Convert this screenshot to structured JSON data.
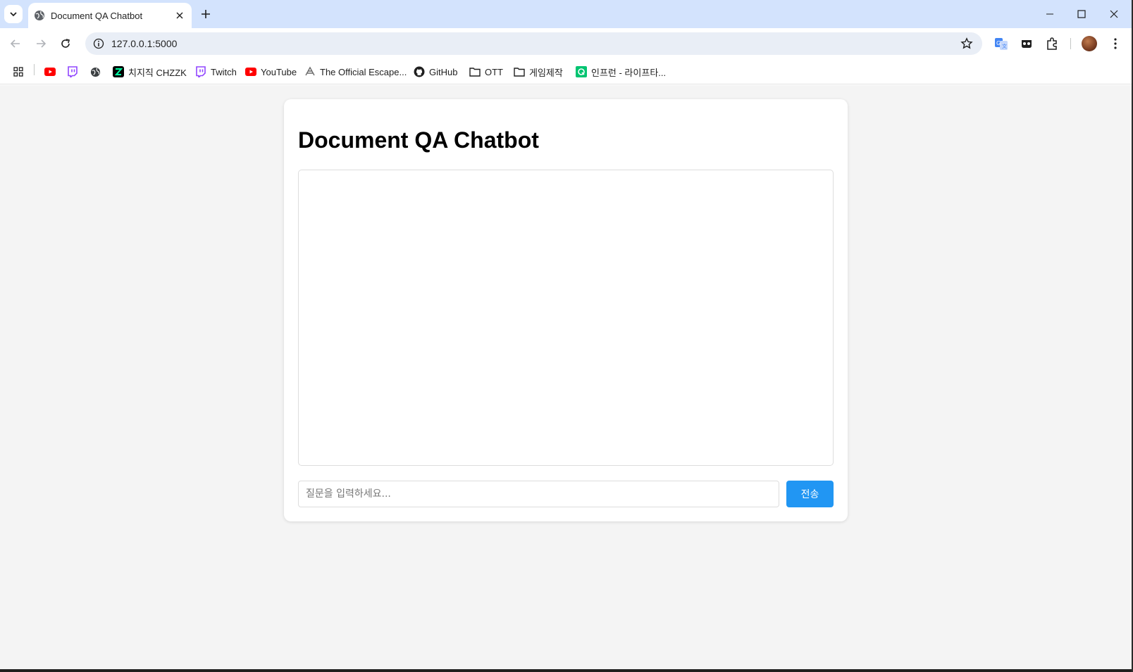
{
  "browser": {
    "tab": {
      "title": "Document QA Chatbot"
    },
    "url": "127.0.0.1:5000",
    "bookmarks": [
      {
        "label": "",
        "icon": "youtube-icon"
      },
      {
        "label": "",
        "icon": "twitch-icon"
      },
      {
        "label": "",
        "icon": "globe-icon"
      },
      {
        "label": "치지직 CHZZK",
        "icon": "chzzk-icon"
      },
      {
        "label": "Twitch",
        "icon": "twitch-icon"
      },
      {
        "label": "YouTube",
        "icon": "youtube-icon"
      },
      {
        "label": "The Official Escape...",
        "icon": "escape-icon"
      },
      {
        "label": "GitHub",
        "icon": "github-icon"
      },
      {
        "label": "OTT",
        "icon": "folder-icon"
      },
      {
        "label": "게임제작",
        "icon": "folder-icon"
      },
      {
        "label": "인프런 - 라이프타...",
        "icon": "inflearn-icon"
      }
    ]
  },
  "page": {
    "title": "Document QA Chatbot",
    "input": {
      "placeholder": "질문을 입력하세요...",
      "value": ""
    },
    "send_label": "전송"
  },
  "colors": {
    "accent": "#2196f3",
    "page_background": "#f4f4f4",
    "tabstrip": "#d3e3fd"
  }
}
